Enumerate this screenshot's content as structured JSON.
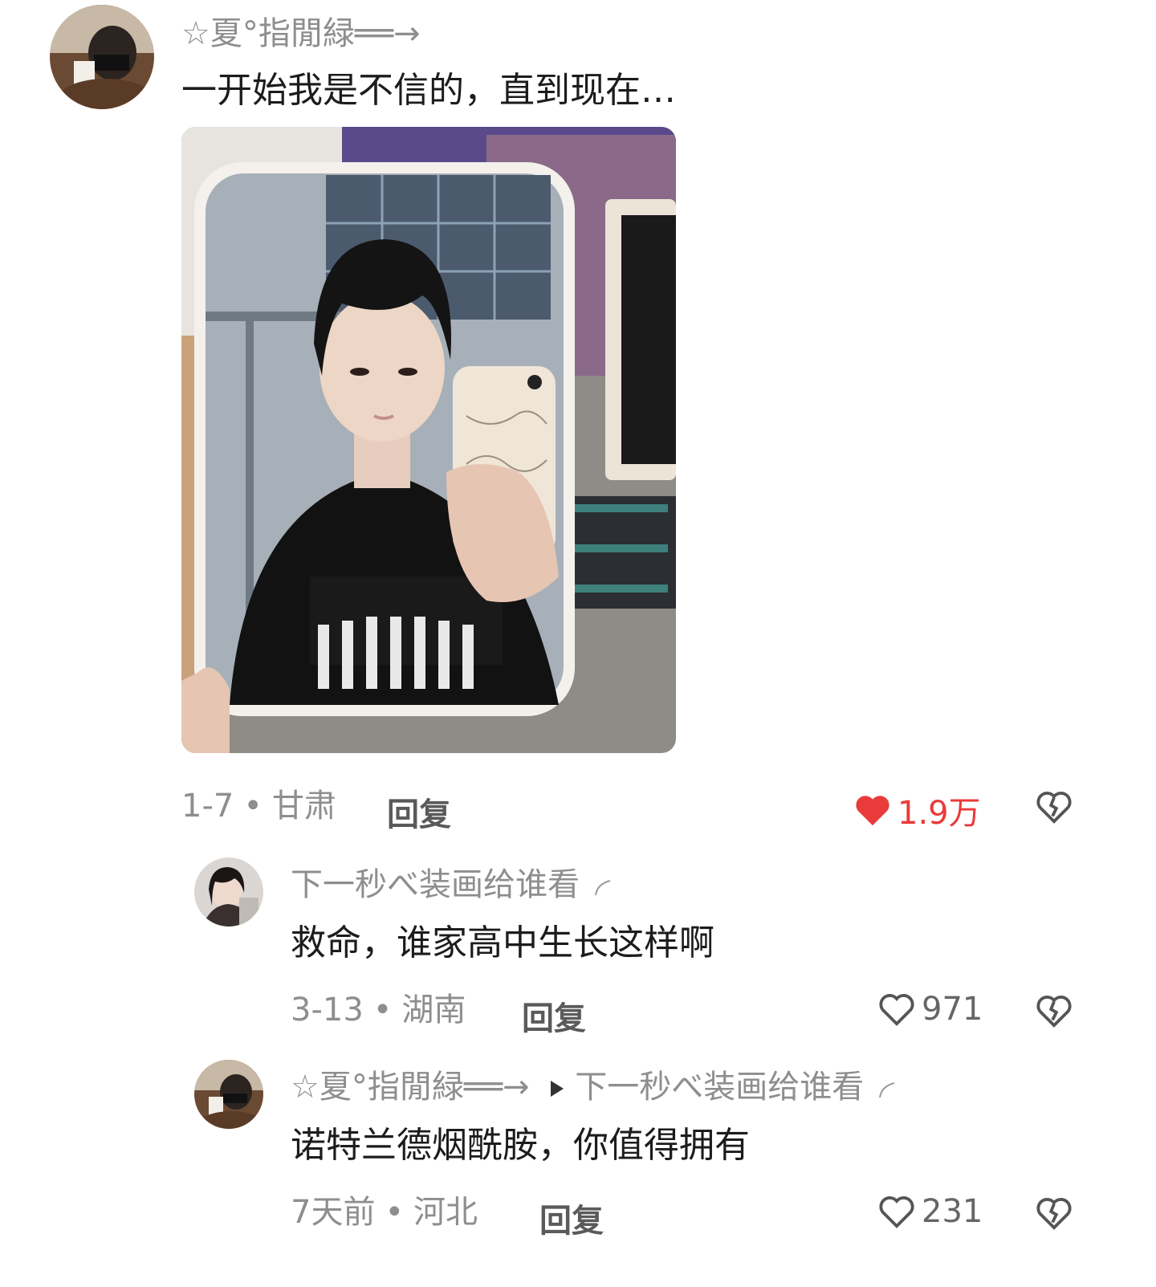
{
  "comment": {
    "author": "☆夏°指閒緑══→",
    "text": "一开始我是不信的，直到现在…",
    "date": "1-7",
    "location": "甘肃",
    "reply_label": "回复",
    "likes": "1.9万",
    "liked": true,
    "like_color": "#ea3b3b"
  },
  "replies": [
    {
      "author": "下一秒べ装画给谁看",
      "text": "救命，谁家高中生长这样啊",
      "date": "3-13",
      "location": "湖南",
      "reply_label": "回复",
      "likes": "971"
    },
    {
      "author": "☆夏°指閒緑══→",
      "reply_to": "下一秒べ装画给谁看",
      "text": "诺特兰德烟酰胺，你值得拥有",
      "date": "7天前",
      "location": "河北",
      "reply_label": "回复",
      "likes": "231"
    }
  ],
  "icons": {
    "heart_filled": "heart-filled-icon",
    "heart_outline": "heart-outline-icon",
    "broken_heart": "broken-heart-icon",
    "play_arrow": "play-triangle-icon"
  }
}
